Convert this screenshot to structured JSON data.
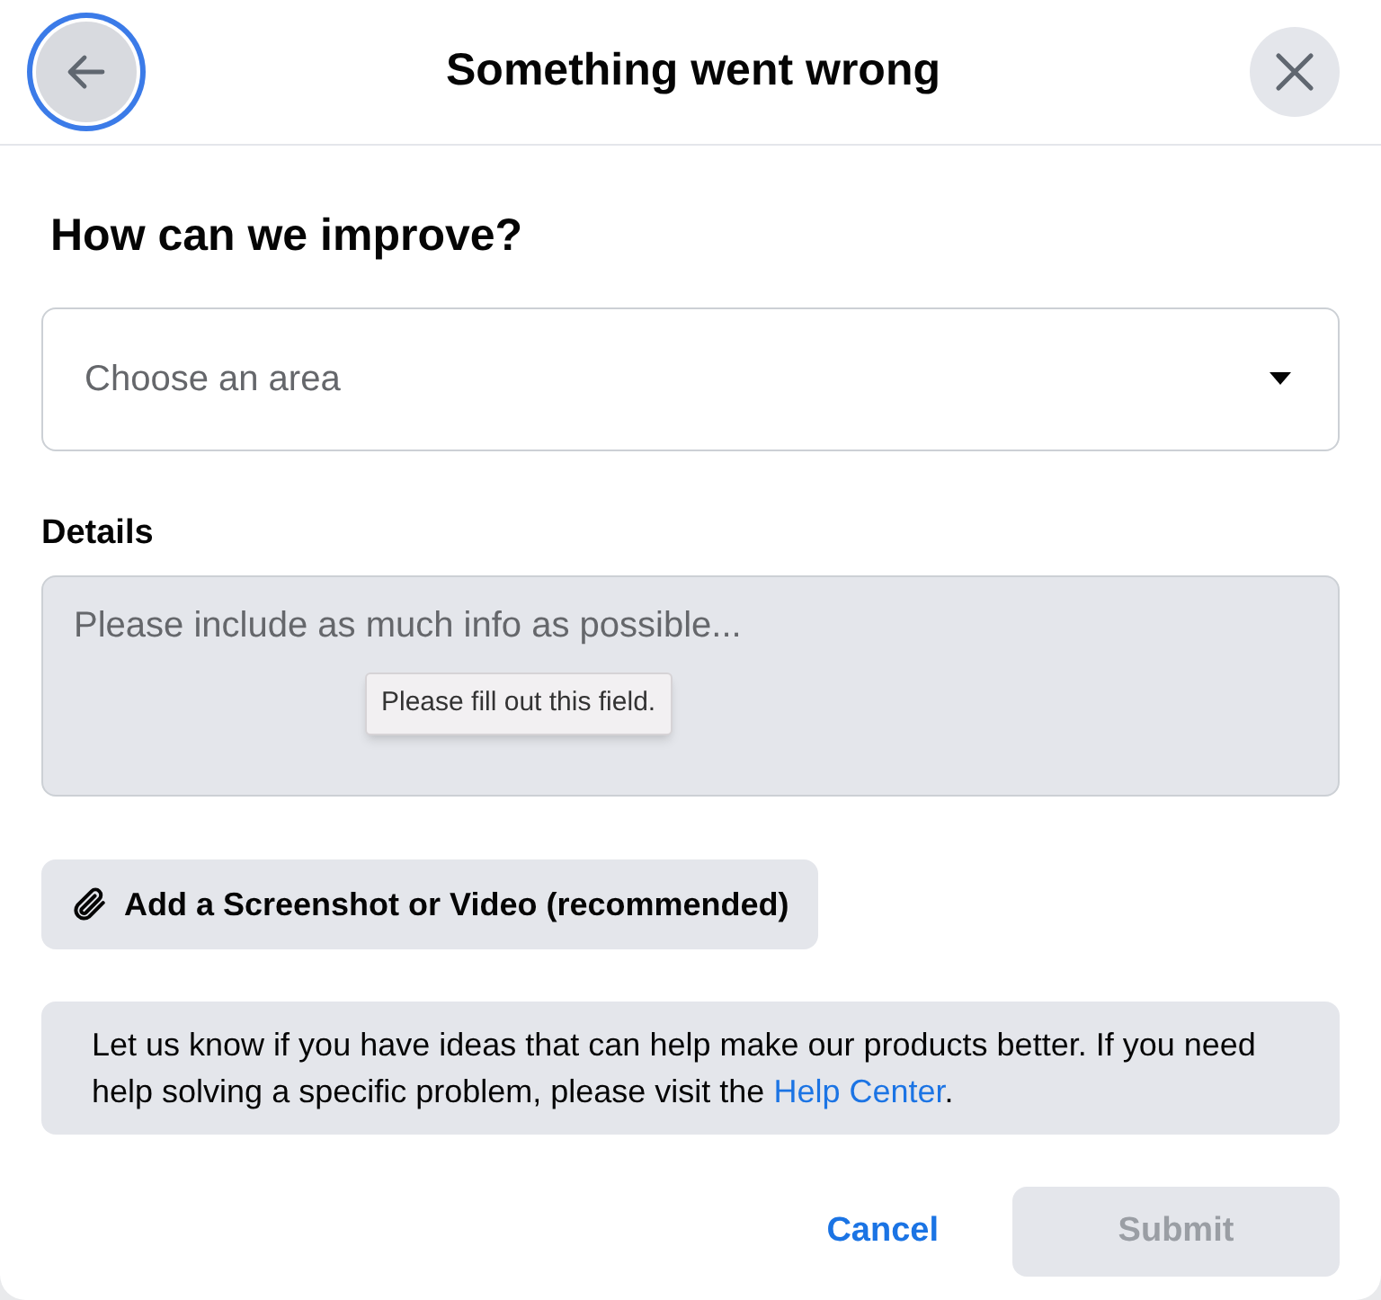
{
  "header": {
    "title": "Something went wrong",
    "back_button": {
      "focused": true
    }
  },
  "heading": "How can we improve?",
  "area_select": {
    "placeholder": "Choose an area"
  },
  "details": {
    "label": "Details",
    "placeholder": "Please include as much info as possible...",
    "tooltip": "Please fill out this field."
  },
  "attach_button": {
    "label": "Add a Screenshot or Video (recommended)"
  },
  "info": {
    "text": "Let us know if you have ideas that can help make our products better. If you need help solving a specific problem, please visit the ",
    "link": "Help Center",
    "text_end": "."
  },
  "buttons": [
    {
      "label": "Cancel",
      "kind": "link",
      "disabled": false
    },
    {
      "label": "Submit",
      "kind": "primary",
      "disabled": true
    }
  ]
}
